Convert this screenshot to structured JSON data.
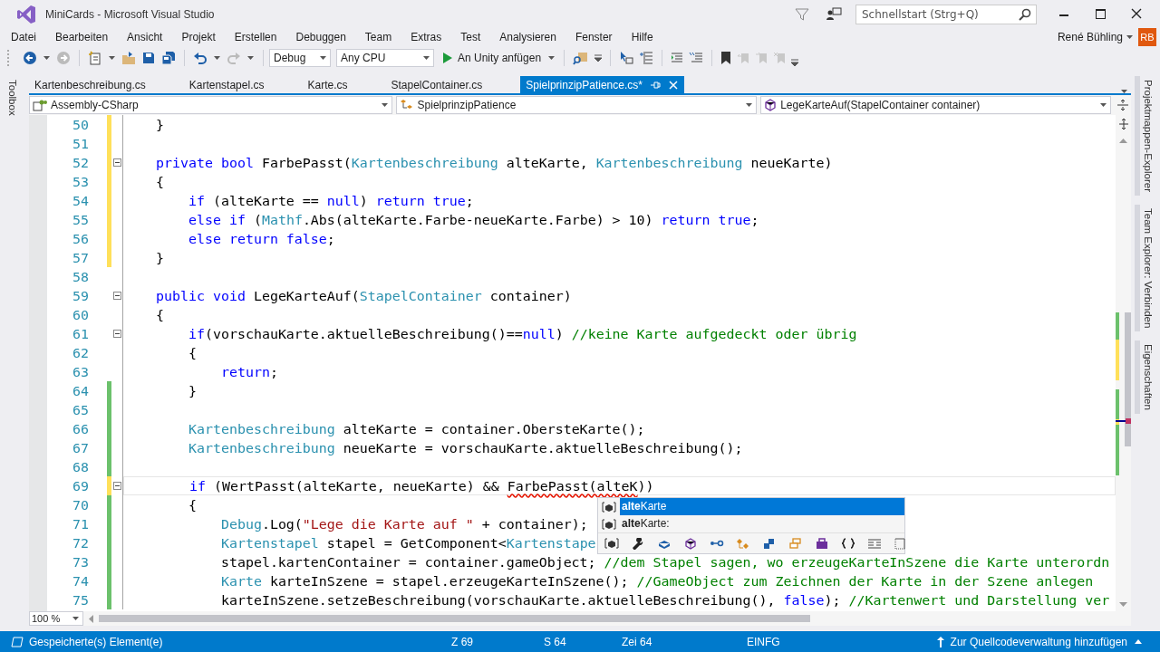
{
  "window": {
    "title": "MiniCards - Microsoft Visual Studio",
    "search_placeholder": "Schnellstart (Strg+Q)",
    "user": "René Bühling",
    "avatar": "RB"
  },
  "menu": [
    "Datei",
    "Bearbeiten",
    "Ansicht",
    "Projekt",
    "Erstellen",
    "Debuggen",
    "Team",
    "Extras",
    "Test",
    "Analysieren",
    "Fenster",
    "Hilfe"
  ],
  "toolbar": {
    "configuration": "Debug",
    "platform": "Any CPU",
    "start": "An Unity anfügen"
  },
  "left_panel": "Toolbox",
  "tabs": [
    {
      "label": "Kartenbeschreibung.cs",
      "selected": false
    },
    {
      "label": "Kartenstapel.cs",
      "selected": false
    },
    {
      "label": "Karte.cs",
      "selected": false
    },
    {
      "label": "StapelContainer.cs",
      "selected": false
    },
    {
      "label": "SpielprinzipPatience.cs*",
      "selected": true
    }
  ],
  "navigation": {
    "project": "Assembly-CSharp",
    "type": "SpielprinzipPatience",
    "member": "LegeKarteAuf(StapelContainer container)"
  },
  "code_lines": [
    {
      "number": "50",
      "changed": true,
      "saved": false,
      "fold": false,
      "current": false,
      "tokens": [
        {
          "kind": "plain",
          "text": "    }"
        }
      ]
    },
    {
      "number": "51",
      "changed": true,
      "saved": false,
      "fold": false,
      "current": false
    },
    {
      "number": "52",
      "changed": true,
      "saved": false,
      "fold": true,
      "current": false,
      "tokens": [
        {
          "kind": "keyword",
          "text": "    private bool"
        },
        {
          "kind": "plain",
          "text": " FarbePasst("
        },
        {
          "kind": "type",
          "text": "Kartenbeschreibung"
        },
        {
          "kind": "plain",
          "text": " alteKarte, "
        },
        {
          "kind": "type",
          "text": "Kartenbeschreibung"
        },
        {
          "kind": "plain",
          "text": " neueKarte)"
        }
      ]
    },
    {
      "number": "53",
      "changed": true,
      "saved": false,
      "fold": false,
      "current": false,
      "tokens": [
        {
          "kind": "plain",
          "text": "    {"
        }
      ]
    },
    {
      "number": "54",
      "changed": true,
      "saved": false,
      "fold": false,
      "current": false,
      "tokens": [
        {
          "kind": "keyword",
          "text": "        if"
        },
        {
          "kind": "plain",
          "text": " (alteKarte == "
        },
        {
          "kind": "keyword",
          "text": "null"
        },
        {
          "kind": "plain",
          "text": ") "
        },
        {
          "kind": "keyword",
          "text": "return true"
        },
        {
          "kind": "plain",
          "text": ";"
        }
      ]
    },
    {
      "number": "55",
      "changed": true,
      "saved": false,
      "fold": false,
      "current": false,
      "tokens": [
        {
          "kind": "keyword",
          "text": "        else if"
        },
        {
          "kind": "plain",
          "text": " ("
        },
        {
          "kind": "type",
          "text": "Mathf"
        },
        {
          "kind": "plain",
          "text": ".Abs(alteKarte.Farbe-neueKarte.Farbe) > 10) "
        },
        {
          "kind": "keyword",
          "text": "return true"
        },
        {
          "kind": "plain",
          "text": ";"
        }
      ]
    },
    {
      "number": "56",
      "changed": true,
      "saved": false,
      "fold": false,
      "current": false,
      "tokens": [
        {
          "kind": "keyword",
          "text": "        else return false"
        },
        {
          "kind": "plain",
          "text": ";"
        }
      ]
    },
    {
      "number": "57",
      "changed": true,
      "saved": false,
      "fold": false,
      "current": false,
      "tokens": [
        {
          "kind": "plain",
          "text": "    }"
        }
      ]
    },
    {
      "number": "58",
      "changed": false,
      "fold": false,
      "current": false
    },
    {
      "number": "59",
      "changed": false,
      "fold": true,
      "current": false,
      "tokens": [
        {
          "kind": "keyword",
          "text": "    public void"
        },
        {
          "kind": "plain",
          "text": " LegeKarteAuf("
        },
        {
          "kind": "type",
          "text": "StapelContainer"
        },
        {
          "kind": "plain",
          "text": " container)"
        }
      ]
    },
    {
      "number": "60",
      "changed": false,
      "fold": false,
      "current": false,
      "tokens": [
        {
          "kind": "plain",
          "text": "    {"
        }
      ]
    },
    {
      "number": "61",
      "changed": false,
      "fold": true,
      "current": false,
      "tokens": [
        {
          "kind": "keyword",
          "text": "        if"
        },
        {
          "kind": "plain",
          "text": "(vorschauKarte.aktuelleBeschreibung()=="
        },
        {
          "kind": "keyword",
          "text": "null"
        },
        {
          "kind": "plain",
          "text": ") "
        },
        {
          "kind": "comment",
          "text": "//keine Karte aufgedeckt oder übrig"
        }
      ]
    },
    {
      "number": "62",
      "changed": false,
      "fold": false,
      "current": false,
      "tokens": [
        {
          "kind": "plain",
          "text": "        {"
        }
      ]
    },
    {
      "number": "63",
      "changed": false,
      "fold": false,
      "current": false,
      "tokens": [
        {
          "kind": "keyword",
          "text": "            return"
        },
        {
          "kind": "plain",
          "text": ";"
        }
      ]
    },
    {
      "number": "64",
      "changed": true,
      "saved": true,
      "fold": false,
      "current": false,
      "tokens": [
        {
          "kind": "plain",
          "text": "        }"
        }
      ]
    },
    {
      "number": "65",
      "changed": true,
      "saved": true,
      "fold": false,
      "current": false
    },
    {
      "number": "66",
      "changed": true,
      "saved": true,
      "fold": false,
      "current": false,
      "tokens": [
        {
          "kind": "type",
          "text": "        Kartenbeschreibung"
        },
        {
          "kind": "plain",
          "text": " alteKarte = container.ObersteKarte();"
        }
      ]
    },
    {
      "number": "67",
      "changed": true,
      "saved": true,
      "fold": false,
      "current": false,
      "tokens": [
        {
          "kind": "type",
          "text": "        Kartenbeschreibung"
        },
        {
          "kind": "plain",
          "text": " neueKarte = vorschauKarte.aktuelleBeschreibung();"
        }
      ]
    },
    {
      "number": "68",
      "changed": true,
      "saved": true,
      "fold": false,
      "current": false
    },
    {
      "number": "69",
      "changed": true,
      "saved": false,
      "fold": true,
      "current": true,
      "tokens": [
        {
          "kind": "keyword",
          "text": "        if"
        },
        {
          "kind": "plain",
          "text": " (WertPasst(alteKarte, neueKarte) && "
        },
        {
          "kind": "error",
          "text": "FarbePasst(alteK"
        },
        {
          "kind": "plain",
          "text": "))"
        }
      ]
    },
    {
      "number": "70",
      "changed": true,
      "saved": true,
      "fold": false,
      "current": false,
      "tokens": [
        {
          "kind": "plain",
          "text": "        {"
        }
      ]
    },
    {
      "number": "71",
      "changed": true,
      "saved": true,
      "fold": false,
      "current": false,
      "tokens": [
        {
          "kind": "type",
          "text": "            Debug"
        },
        {
          "kind": "plain",
          "text": ".Log("
        },
        {
          "kind": "string",
          "text": "\"Lege die Karte auf \""
        },
        {
          "kind": "plain",
          "text": " + container);"
        }
      ]
    },
    {
      "number": "72",
      "changed": true,
      "saved": true,
      "fold": false,
      "current": false,
      "tokens": [
        {
          "kind": "type",
          "text": "            Kartenstapel"
        },
        {
          "kind": "plain",
          "text": " stapel = GetComponent<"
        },
        {
          "kind": "type",
          "text": "Kartenstape"
        }
      ]
    },
    {
      "number": "73",
      "changed": true,
      "saved": true,
      "fold": false,
      "current": false,
      "tokens": [
        {
          "kind": "plain",
          "text": "            stapel.kartenContainer = container.gameObject; "
        },
        {
          "kind": "comment",
          "text": "//dem Stapel sagen, wo erzeugeKarteInSzene die Karte unterordn"
        }
      ]
    },
    {
      "number": "74",
      "changed": true,
      "saved": true,
      "fold": false,
      "current": false,
      "tokens": [
        {
          "kind": "type",
          "text": "            Karte"
        },
        {
          "kind": "plain",
          "text": " karteInSzene = stapel.erzeugeKarteInSzene(); "
        },
        {
          "kind": "comment",
          "text": "//GameObject zum Zeichnen der Karte in der Szene anlegen"
        }
      ]
    },
    {
      "number": "75",
      "changed": true,
      "saved": true,
      "fold": false,
      "current": false,
      "tokens": [
        {
          "kind": "plain",
          "text": "            karteInSzene.setzeBeschreibung(vorschauKarte.aktuelleBeschreibung(), "
        },
        {
          "kind": "keyword",
          "text": "false"
        },
        {
          "kind": "plain",
          "text": "); "
        },
        {
          "kind": "comment",
          "text": "//Kartenwert und Darstellung ver"
        }
      ]
    }
  ],
  "completion": [
    {
      "label": "**alte**Karte",
      "selected": true
    },
    {
      "label": "**alte**Karte:",
      "selected": false
    }
  ],
  "zoom": "100 %",
  "right_panels": [
    "Projektmappen-Explorer",
    "Team Explorer: Verbinden",
    "Eigenschaften"
  ],
  "status_bar": {
    "message": "Gespeicherte(s) Element(e)",
    "line": "Z 69",
    "column": "S 64",
    "char": "Zei 64",
    "mode": "EINFG",
    "source_control": "Zur Quellcodeverwaltung hinzufügen"
  }
}
